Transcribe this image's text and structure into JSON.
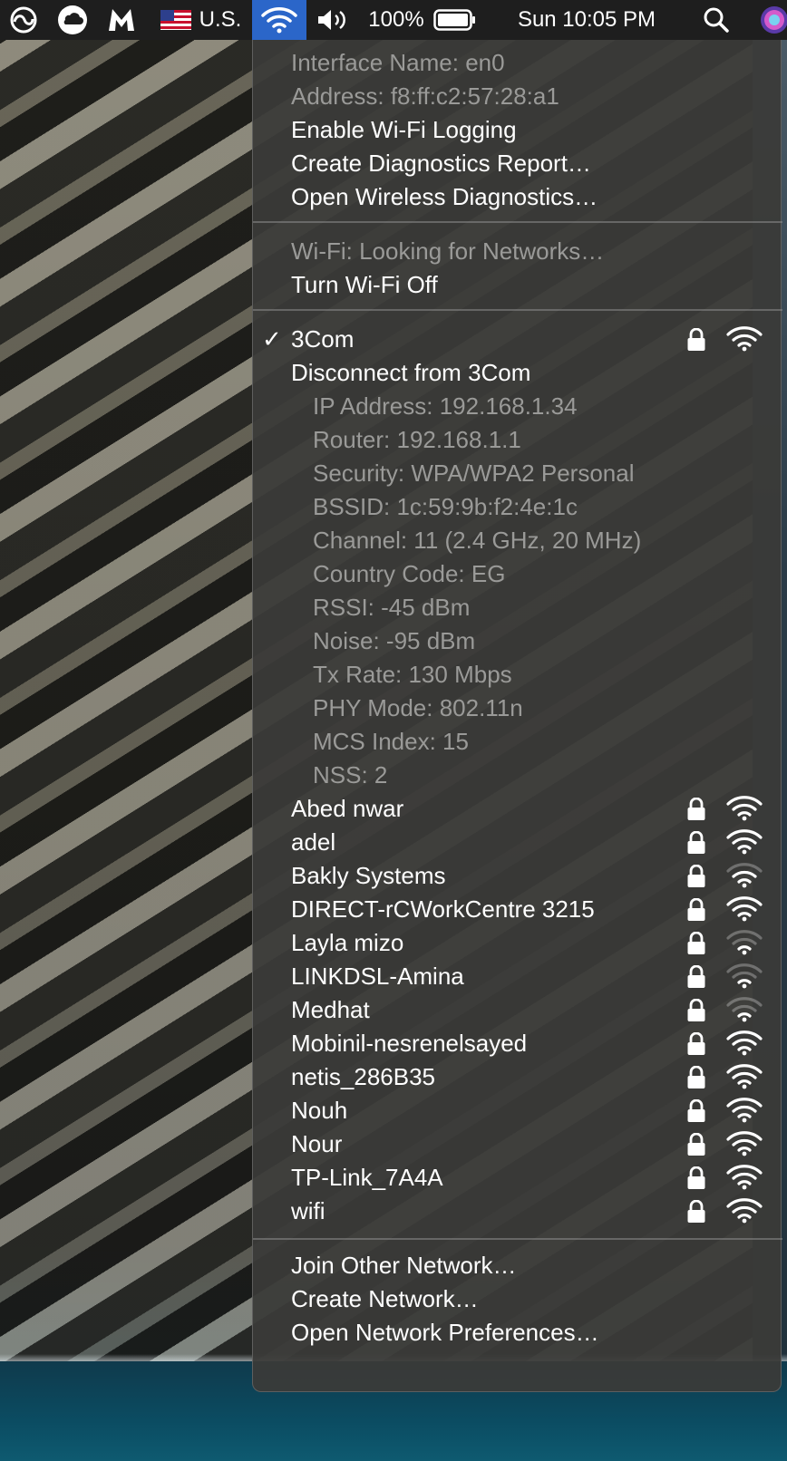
{
  "menubar": {
    "region_label": "U.S.",
    "battery": "100%",
    "clock": "Sun 10:05 PM",
    "icons": [
      "creative-cloud-icon",
      "icloud-icon",
      "malwarebytes-icon",
      "us-flag-icon",
      "wifi-icon",
      "volume-icon",
      "battery-icon",
      "spotlight-search-icon",
      "siri-icon"
    ]
  },
  "menu": {
    "interface_name": "Interface Name: en0",
    "address": "Address: f8:ff:c2:57:28:a1",
    "enable_logging": "Enable Wi-Fi Logging",
    "create_report": "Create Diagnostics Report…",
    "open_diagnostics": "Open Wireless Diagnostics…",
    "status": "Wi-Fi: Looking for Networks…",
    "turn_off": "Turn Wi-Fi Off",
    "connected": {
      "check": "✓",
      "name": "3Com",
      "disconnect": "Disconnect from 3Com",
      "details": [
        "IP Address: 192.168.1.34",
        "Router: 192.168.1.1",
        "Security: WPA/WPA2 Personal",
        "BSSID: 1c:59:9b:f2:4e:1c",
        "Channel: 11 (2.4 GHz, 20 MHz)",
        "Country Code: EG",
        "RSSI: -45 dBm",
        "Noise: -95 dBm",
        "Tx Rate: 130 Mbps",
        "PHY Mode: 802.11n",
        "MCS Index: 15",
        "NSS: 2"
      ]
    },
    "networks": [
      {
        "name": "Abed nwar",
        "bars": 4
      },
      {
        "name": "adel",
        "bars": 4
      },
      {
        "name": "Bakly Systems",
        "bars": 3
      },
      {
        "name": "DIRECT-rCWorkCentre 3215",
        "bars": 4
      },
      {
        "name": "Layla mizo",
        "bars": 2
      },
      {
        "name": "LINKDSL-Amina",
        "bars": 2
      },
      {
        "name": "Medhat",
        "bars": 2
      },
      {
        "name": "Mobinil-nesrenelsayed",
        "bars": 4
      },
      {
        "name": "netis_286B35",
        "bars": 4
      },
      {
        "name": "Nouh",
        "bars": 4
      },
      {
        "name": "Nour",
        "bars": 4
      },
      {
        "name": "TP-Link_7A4A",
        "bars": 4
      },
      {
        "name": "wifi",
        "bars": 4
      }
    ],
    "join_other": "Join Other Network…",
    "create_network": "Create Network…",
    "open_prefs": "Open Network Preferences…"
  }
}
